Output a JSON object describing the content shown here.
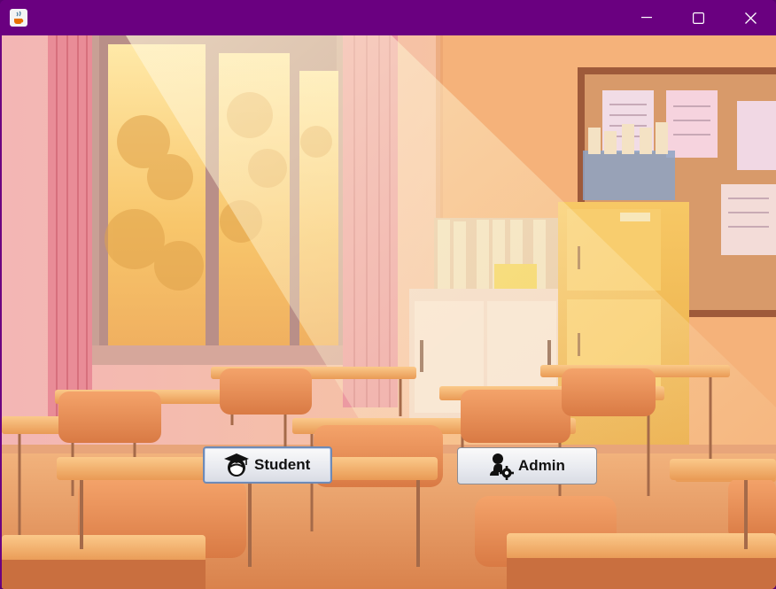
{
  "window": {
    "title": "",
    "icon": "java-cup-icon",
    "controls": [
      "minimize-icon",
      "maximize-icon",
      "close-icon"
    ],
    "titlebar_color": "#6a0080"
  },
  "background": {
    "description_icon": "classroom-background-image"
  },
  "buttons": {
    "student": {
      "label": "Student",
      "icon": "graduate-cap-icon"
    },
    "admin": {
      "label": "Admin",
      "icon": "user-gear-icon"
    }
  }
}
